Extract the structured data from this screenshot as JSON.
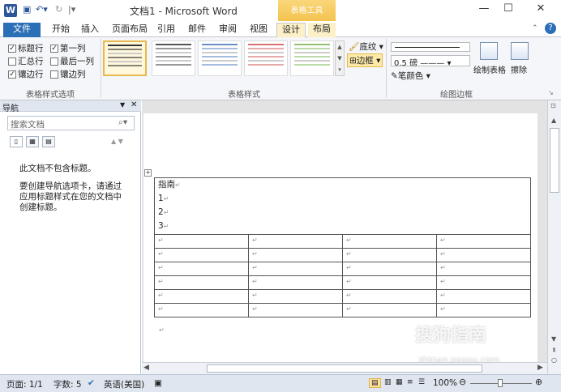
{
  "titlebar": {
    "doc_title": "文档1 - Microsoft Word",
    "context_tab_title": "表格工具",
    "logo": "W",
    "min": "—",
    "max": "☐",
    "close": "✕"
  },
  "tabs": [
    {
      "label": "文件"
    },
    {
      "label": "开始"
    },
    {
      "label": "插入"
    },
    {
      "label": "页面布局"
    },
    {
      "label": "引用"
    },
    {
      "label": "邮件"
    },
    {
      "label": "审阅"
    },
    {
      "label": "视图"
    },
    {
      "label": "设计"
    },
    {
      "label": "布局"
    }
  ],
  "ribbon": {
    "style_options": {
      "items": [
        {
          "label": "标题行",
          "checked": "✓"
        },
        {
          "label": "第一列",
          "checked": "✓"
        },
        {
          "label": "汇总行",
          "checked": ""
        },
        {
          "label": "最后一列",
          "checked": ""
        },
        {
          "label": "镶边行",
          "checked": "✓"
        },
        {
          "label": "镶边列",
          "checked": ""
        }
      ],
      "group_label": "表格样式选项"
    },
    "table_styles": {
      "group_label": "表格样式",
      "shading": "底纹",
      "borders": "边框",
      "tile_colors": [
        "#333333",
        "#555555",
        "#6a8fc7",
        "#d97070",
        "#90c070"
      ]
    },
    "draw_borders": {
      "group_label": "绘图边框",
      "weight": "0.5 磅",
      "pen_color": "笔颜色",
      "draw_table": "绘制表格",
      "eraser": "擦除"
    }
  },
  "nav": {
    "title": "导航",
    "search_placeholder": "搜索文档",
    "no_headings": "此文档不包含标题。",
    "hint": "要创建导航选项卡，请通过应用标题样式在您的文档中创建标题。"
  },
  "document": {
    "merged_lines": [
      "指南",
      "1",
      "2",
      "3"
    ],
    "empty_rows": 6,
    "empty_cols": 4
  },
  "status": {
    "page": "页面: 1/1",
    "words": "字数: 5",
    "language": "英语(美国)",
    "zoom": "100%"
  },
  "watermark": {
    "brand": "搜狗指南",
    "url": "zhinan.sogou.com"
  }
}
